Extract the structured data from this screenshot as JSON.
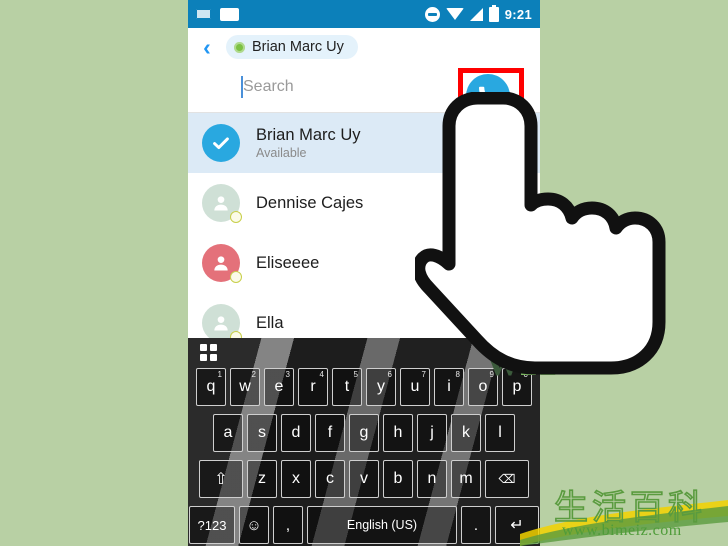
{
  "background_color": "#b8d0a4",
  "status_bar": {
    "left_icons": [
      "keyboard-icon",
      "message-card-icon"
    ],
    "right_icons": [
      "do-not-disturb-icon",
      "wifi-icon",
      "signal-icon",
      "battery-icon"
    ],
    "time": "9:21",
    "background_color": "#0c80ba"
  },
  "header": {
    "back_label": "‹",
    "recipient": {
      "name": "Brian Marc Uy",
      "status_color": "#7cc143"
    }
  },
  "search": {
    "placeholder": "Search",
    "value": ""
  },
  "call_button": {
    "icon": "phone-icon",
    "color": "#29a8e0",
    "highlight_color": "#ff0000"
  },
  "contacts": [
    {
      "name": "Brian Marc Uy",
      "status": "Available",
      "selected": true,
      "avatar_color": "#29a8e0",
      "avatar_type": "check"
    },
    {
      "name": "Dennise Cajes",
      "status": "",
      "selected": false,
      "avatar_color": "#cfe0d6",
      "avatar_type": "person"
    },
    {
      "name": "Eliseeee",
      "status": "",
      "selected": false,
      "avatar_color": "#e4717a",
      "avatar_type": "person"
    },
    {
      "name": "Ella",
      "status": "",
      "selected": false,
      "avatar_color": "#cfe0d6",
      "avatar_type": "person"
    }
  ],
  "keyboard": {
    "toolbar_icon": "grid-icon",
    "row1": [
      {
        "key": "q",
        "num": "1"
      },
      {
        "key": "w",
        "num": "2"
      },
      {
        "key": "e",
        "num": "3"
      },
      {
        "key": "r",
        "num": "4"
      },
      {
        "key": "t",
        "num": "5"
      },
      {
        "key": "y",
        "num": "6"
      },
      {
        "key": "u",
        "num": "7"
      },
      {
        "key": "i",
        "num": "8"
      },
      {
        "key": "o",
        "num": "9"
      },
      {
        "key": "p",
        "num": "0"
      }
    ],
    "row2": [
      "a",
      "s",
      "d",
      "f",
      "g",
      "h",
      "j",
      "k",
      "l"
    ],
    "row3": {
      "shift": "⇧",
      "keys": [
        "z",
        "x",
        "c",
        "v",
        "b",
        "n",
        "m"
      ],
      "backspace": "⌫"
    },
    "row4": {
      "symbols": "?123",
      "emoji": "☺",
      "comma": ",",
      "space": "English (US)",
      "period": ".",
      "enter": "↵"
    }
  },
  "watermarks": {
    "wikihow": {
      "w": "w",
      "h": "H"
    },
    "bimeiz": {
      "chinese": "生活百科",
      "url": "www.bimeiz.com"
    }
  }
}
